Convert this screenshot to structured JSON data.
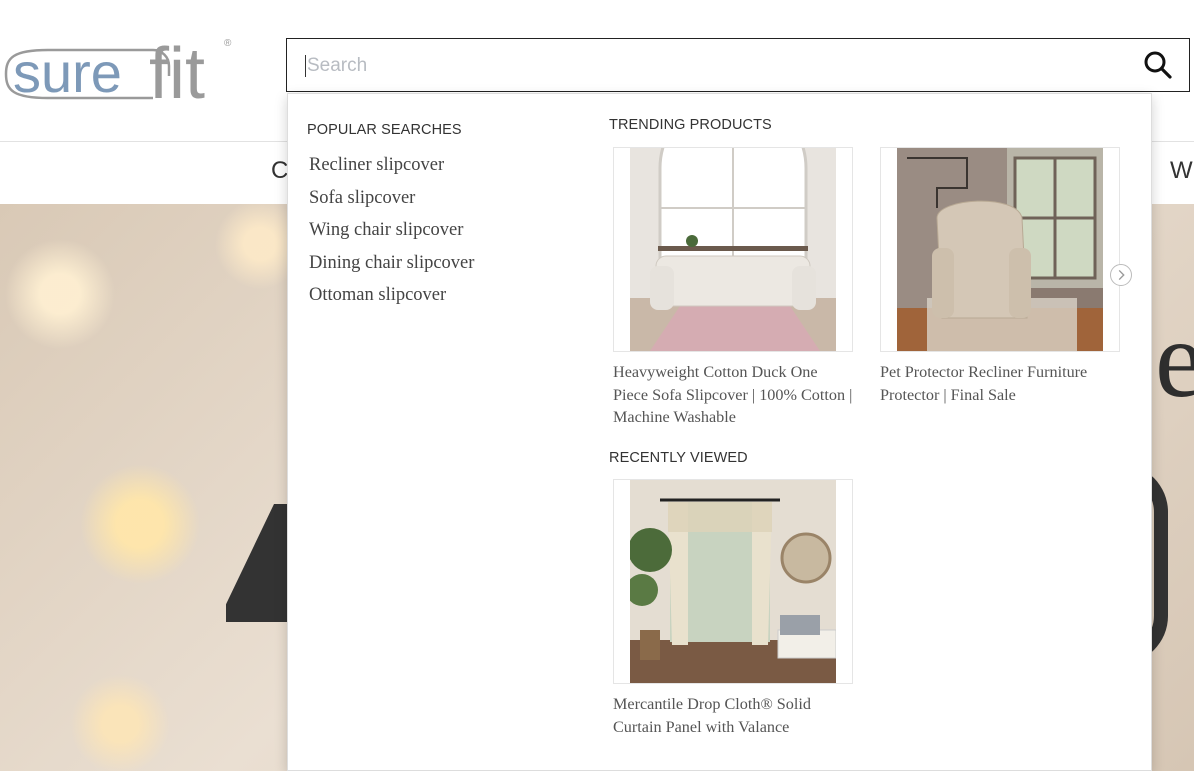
{
  "header": {
    "logo_text": "surefit",
    "logo_trademark": "®"
  },
  "search": {
    "placeholder": "Search",
    "value": ""
  },
  "nav": {
    "items_partial": [
      "C",
      "W"
    ]
  },
  "dropdown": {
    "popular_title": "POPULAR SEARCHES",
    "popular": [
      "Recliner slipcover",
      "Sofa slipcover",
      "Wing chair slipcover",
      "Dining chair slipcover",
      "Ottoman slipcover"
    ],
    "trending_title": "TRENDING PRODUCTS",
    "trending": [
      {
        "title": "Heavyweight Cotton Duck One Piece Sofa Slipcover | 100% Cotton | Machine Washable"
      },
      {
        "title": "Pet Protector Recliner Furniture Protector | Final Sale"
      }
    ],
    "recent_title": "RECENTLY VIEWED",
    "recent": [
      {
        "title": "Mercantile Drop Cloth® Solid Curtain Panel with Valance"
      }
    ]
  },
  "hero": {
    "partial_glyph": "e"
  },
  "colors": {
    "logo_blue": "#7d99b8",
    "logo_gray": "#9a9a9a",
    "text_dark": "#333333"
  },
  "icons": [
    "search-icon",
    "chevron-right-icon"
  ]
}
